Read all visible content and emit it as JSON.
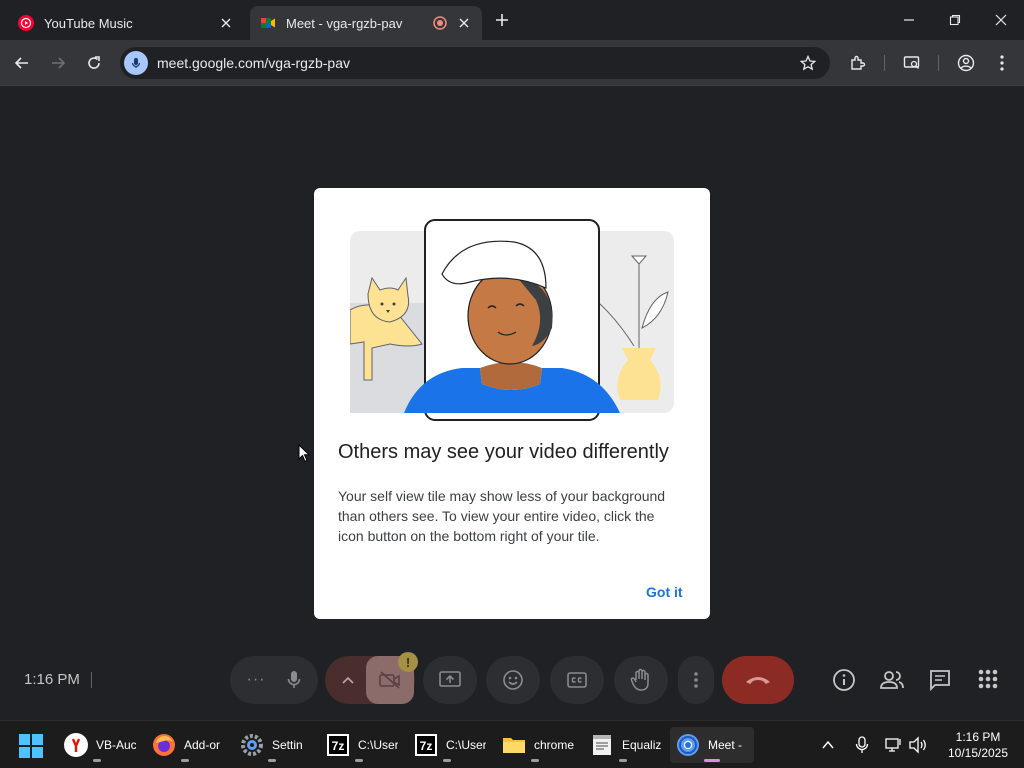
{
  "browser": {
    "tabs": [
      {
        "title": "YouTube Music",
        "active": false
      },
      {
        "title": "Meet - vga-rgzb-pav",
        "active": true
      }
    ],
    "url": "meet.google.com/vga-rgzb-pav"
  },
  "dialog": {
    "title": "Others may see your video differently",
    "body": "Your self view tile may show less of your background than others see. To view your entire video, click the icon button on the bottom right of your tile.",
    "confirm_label": "Got it"
  },
  "meet_bar": {
    "time": "1:16 PM"
  },
  "taskbar": {
    "apps": [
      {
        "label": "VB-Auc",
        "icon": "yandex-icon"
      },
      {
        "label": "Add-or",
        "icon": "firefox-icon"
      },
      {
        "label": "Settin",
        "icon": "settings-icon"
      },
      {
        "label": "C:\\User",
        "icon": "7zip-icon"
      },
      {
        "label": "C:\\User",
        "icon": "7zip-icon"
      },
      {
        "label": "chrome",
        "icon": "folder-icon"
      },
      {
        "label": "Equaliz",
        "icon": "notepad-icon"
      },
      {
        "label": "Meet -",
        "icon": "chrome-icon"
      }
    ],
    "clock_time": "1:16 PM",
    "clock_date": "10/15/2025"
  },
  "colors": {
    "accent": "#1a73e8",
    "end_call": "#d93025",
    "meet_bg": "#202124"
  }
}
